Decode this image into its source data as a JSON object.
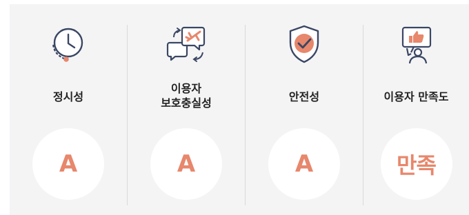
{
  "colors": {
    "accent": "#e7876c",
    "ink": "#3a4663",
    "panel_bg": "#f4f4f5",
    "divider": "#d9d9d9"
  },
  "items": [
    {
      "label": "정시성",
      "grade": "A",
      "icon": "clock-icon"
    },
    {
      "label_line1": "이용자",
      "label_line2": "보호충실성",
      "grade": "A",
      "icon": "chat-airplane-icon"
    },
    {
      "label": "안전성",
      "grade": "A",
      "icon": "shield-check-icon"
    },
    {
      "label": "이용자 만족도",
      "grade": "만족",
      "icon": "thumbs-up-user-icon"
    }
  ]
}
